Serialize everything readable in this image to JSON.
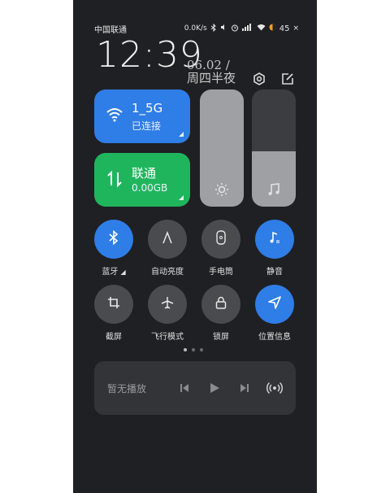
{
  "status_bar": {
    "carrier": "中国联通",
    "speed": "0.0K/s",
    "battery": "45"
  },
  "clock": {
    "time": "12:39",
    "date": "06.02 /",
    "weekday": "周四半夜"
  },
  "header_icons": [
    "settings-icon",
    "edit-icon"
  ],
  "wifi_tile": {
    "title": "1_5G",
    "subtitle": "已连接",
    "color": "#2f7de6"
  },
  "mobile_tile": {
    "title": "联通",
    "subtitle": "0.00GB",
    "color": "#1fb55d"
  },
  "brightness_slider": {
    "level": 1.0,
    "icon": "sun-icon"
  },
  "volume_slider": {
    "level": 0.47,
    "icon": "music-note-icon"
  },
  "toggles": [
    {
      "label": "蓝牙",
      "icon": "bluetooth-icon",
      "on": true
    },
    {
      "label": "自动亮度",
      "icon": "auto-brightness-icon",
      "on": false
    },
    {
      "label": "手电筒",
      "icon": "flashlight-icon",
      "on": false
    },
    {
      "label": "静音",
      "icon": "mute-icon",
      "on": true
    },
    {
      "label": "截屏",
      "icon": "screenshot-icon",
      "on": false
    },
    {
      "label": "飞行模式",
      "icon": "airplane-icon",
      "on": false
    },
    {
      "label": "锁屏",
      "icon": "lock-icon",
      "on": false
    },
    {
      "label": "位置信息",
      "icon": "location-icon",
      "on": true
    }
  ],
  "page_indicator": {
    "pages": 3,
    "current": 0
  },
  "media": {
    "text": "暂无播放"
  }
}
